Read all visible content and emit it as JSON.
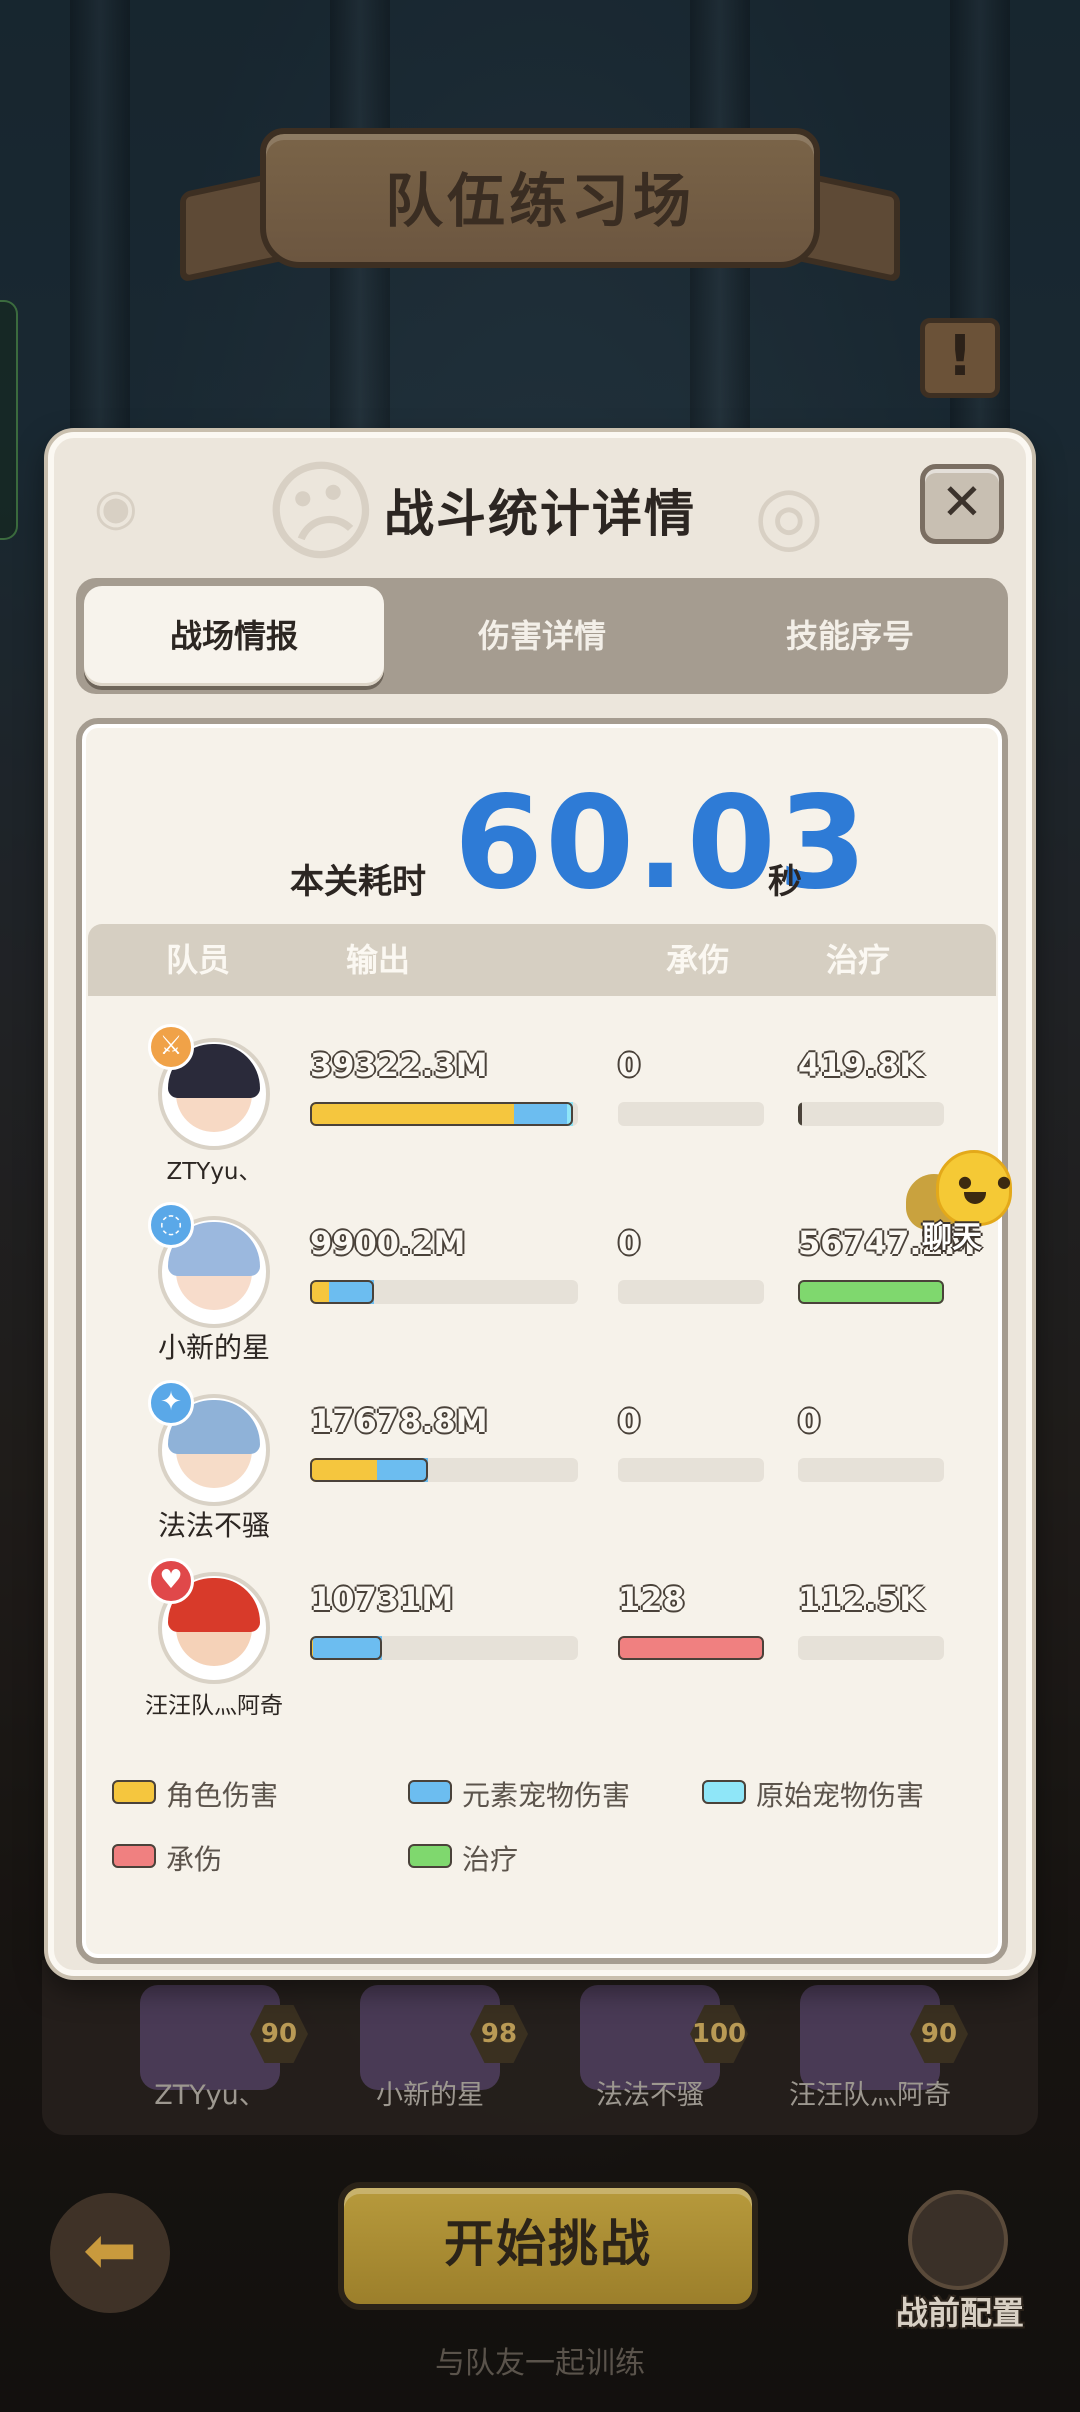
{
  "background": {
    "banner_title": "队伍练习场",
    "team": [
      {
        "name": "ZTYyu、",
        "level": "90"
      },
      {
        "name": "小新的星",
        "level": "98"
      },
      {
        "name": "法法不骚",
        "level": "100"
      },
      {
        "name": "汪汪队灬阿奇",
        "level": "90"
      }
    ],
    "start_label": "开始挑战",
    "hint": "与队友一起训练",
    "preset_label": "战前配置"
  },
  "modal": {
    "title": "战斗统计详情",
    "close_glyph": "✕",
    "tabs": [
      {
        "label": "战场情报",
        "active": true
      },
      {
        "label": "伤害详情",
        "active": false
      },
      {
        "label": "技能序号",
        "active": false
      }
    ],
    "time_label": "本关耗时",
    "time_value": "60.03",
    "time_unit": "秒",
    "columns": {
      "member": "队员",
      "output": "输出",
      "tank": "承伤",
      "heal": "治疗"
    },
    "rows": [
      {
        "name": "ZTYyu、",
        "badge_icon": "sword-icon",
        "badge_color": "#f0a248",
        "output": "39322.3M",
        "output_role_frac": 0.76,
        "output_elem_frac": 0.2,
        "output_orig_frac": 0.02,
        "tank": "0",
        "tank_frac": 0,
        "heal": "419.8K",
        "heal_frac": 0.01
      },
      {
        "name": "小新的星",
        "badge_icon": "swirl-icon",
        "badge_color": "#5aa8e8",
        "output": "9900.2M",
        "output_role_frac": 0.07,
        "output_elem_frac": 0.17,
        "output_orig_frac": 0,
        "tank": "0",
        "tank_frac": 0,
        "heal": "56747.2M",
        "heal_frac": 1.0
      },
      {
        "name": "法法不骚",
        "badge_icon": "wand-icon",
        "badge_color": "#5aa8e8",
        "output": "17678.8M",
        "output_role_frac": 0.25,
        "output_elem_frac": 0.19,
        "output_orig_frac": 0,
        "tank": "0",
        "tank_frac": 0,
        "heal": "0",
        "heal_frac": 0
      },
      {
        "name": "汪汪队灬阿奇",
        "badge_icon": "shield-heart-icon",
        "badge_color": "#e0484a",
        "output": "10731M",
        "output_role_frac": 0.01,
        "output_elem_frac": 0.26,
        "output_orig_frac": 0,
        "tank": "128",
        "tank_frac": 1.0,
        "heal": "112.5K",
        "heal_frac": 0
      }
    ],
    "legend": [
      {
        "label": "角色伤害",
        "color": "#f5c63e"
      },
      {
        "label": "元素宠物伤害",
        "color": "#6cbdf0"
      },
      {
        "label": "原始宠物伤害",
        "color": "#8fe6f8"
      },
      {
        "label": "承伤",
        "color": "#f08080"
      },
      {
        "label": "治疗",
        "color": "#7fd86e"
      }
    ],
    "chat_label": "聊天"
  }
}
